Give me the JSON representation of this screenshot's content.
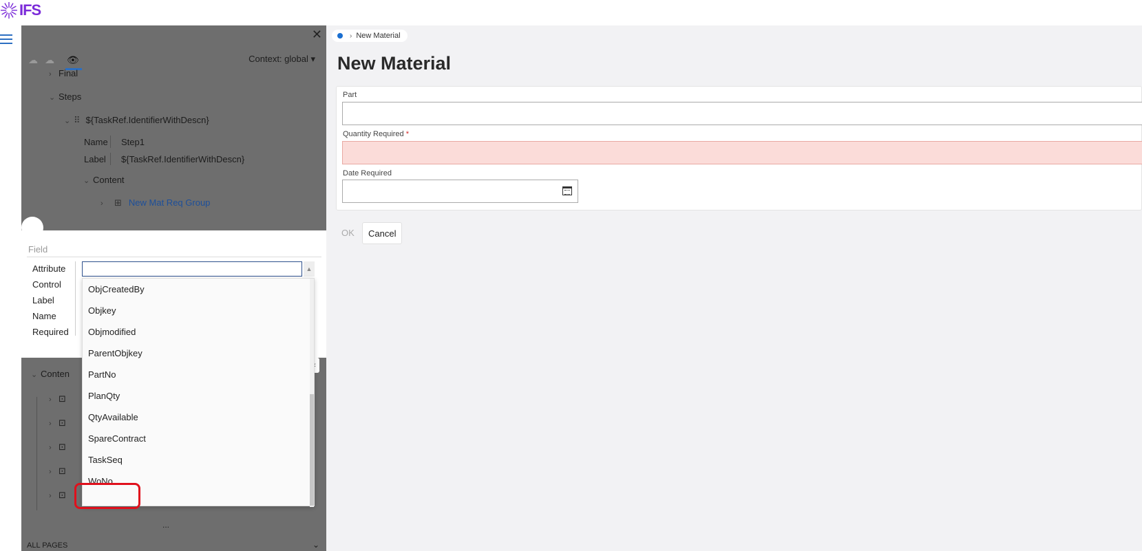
{
  "brand": {
    "logo_text": "IFS",
    "accent": "#7b2bd9"
  },
  "left_panel": {
    "context_label": "Context: global",
    "tree": {
      "final": "Final",
      "steps": "Steps",
      "step_title": "${TaskRef.IdentifierWithDescn}",
      "name_key": "Name",
      "name_value": "Step1",
      "label_key": "Label",
      "label_value": "${TaskRef.IdentifierWithDescn}",
      "content": "Content",
      "group": "New Mat Req Group",
      "content2": "Conten"
    },
    "dots": "...",
    "bottom_label": "ALL PAGES"
  },
  "field_popover": {
    "title": "Field",
    "labels": [
      "Attribute",
      "Control",
      "Label",
      "Name",
      "Required"
    ],
    "attribute_value": "",
    "options": [
      "ObjCreatedBy",
      "Objkey",
      "Objmodified",
      "ParentObjkey",
      "PartNo",
      "PlanQty",
      "QtyAvailable",
      "SpareContract",
      "TaskSeq",
      "WoNo"
    ],
    "highlighted_option": "WoNo"
  },
  "main": {
    "breadcrumb_current": "New Material",
    "page_title": "New Material",
    "fields": {
      "part_label": "Part",
      "part_value": "",
      "qty_label": "Quantity Required",
      "qty_required_mark": "*",
      "qty_value": "",
      "date_label": "Date Required",
      "date_value": ""
    },
    "buttons": {
      "ok": "OK",
      "cancel": "Cancel"
    }
  }
}
